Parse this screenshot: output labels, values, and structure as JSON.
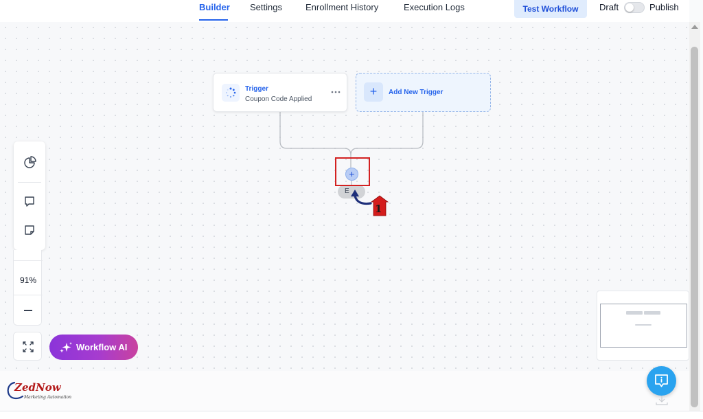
{
  "header": {
    "tabs": [
      {
        "label": "Builder",
        "active": true
      },
      {
        "label": "Settings",
        "active": false
      },
      {
        "label": "Enrollment History",
        "active": false
      },
      {
        "label": "Execution Logs",
        "active": false
      }
    ],
    "test_workflow_label": "Test Workflow",
    "draft_label": "Draft",
    "publish_label": "Publish",
    "published": false
  },
  "workflow": {
    "trigger": {
      "title": "Trigger",
      "subtitle": "Coupon Code Applied",
      "more_icon": "more-horizontal-icon"
    },
    "add_trigger": {
      "label": "Add New Trigger",
      "icon": "+"
    },
    "add_action_icon": "+",
    "end_label": "E"
  },
  "annotation": {
    "step_number": "1"
  },
  "zoom": {
    "value": "91%"
  },
  "workflow_ai": {
    "label": "Workflow AI"
  },
  "logo": {
    "text": "ZedNow",
    "tagline": "Marketing Automation"
  },
  "colors": {
    "accent": "#2563eb",
    "highlight": "#d32121",
    "ai_gradient_start": "#8b34d9",
    "ai_gradient_end": "#c9429f",
    "help_button": "#2aa3ef"
  }
}
